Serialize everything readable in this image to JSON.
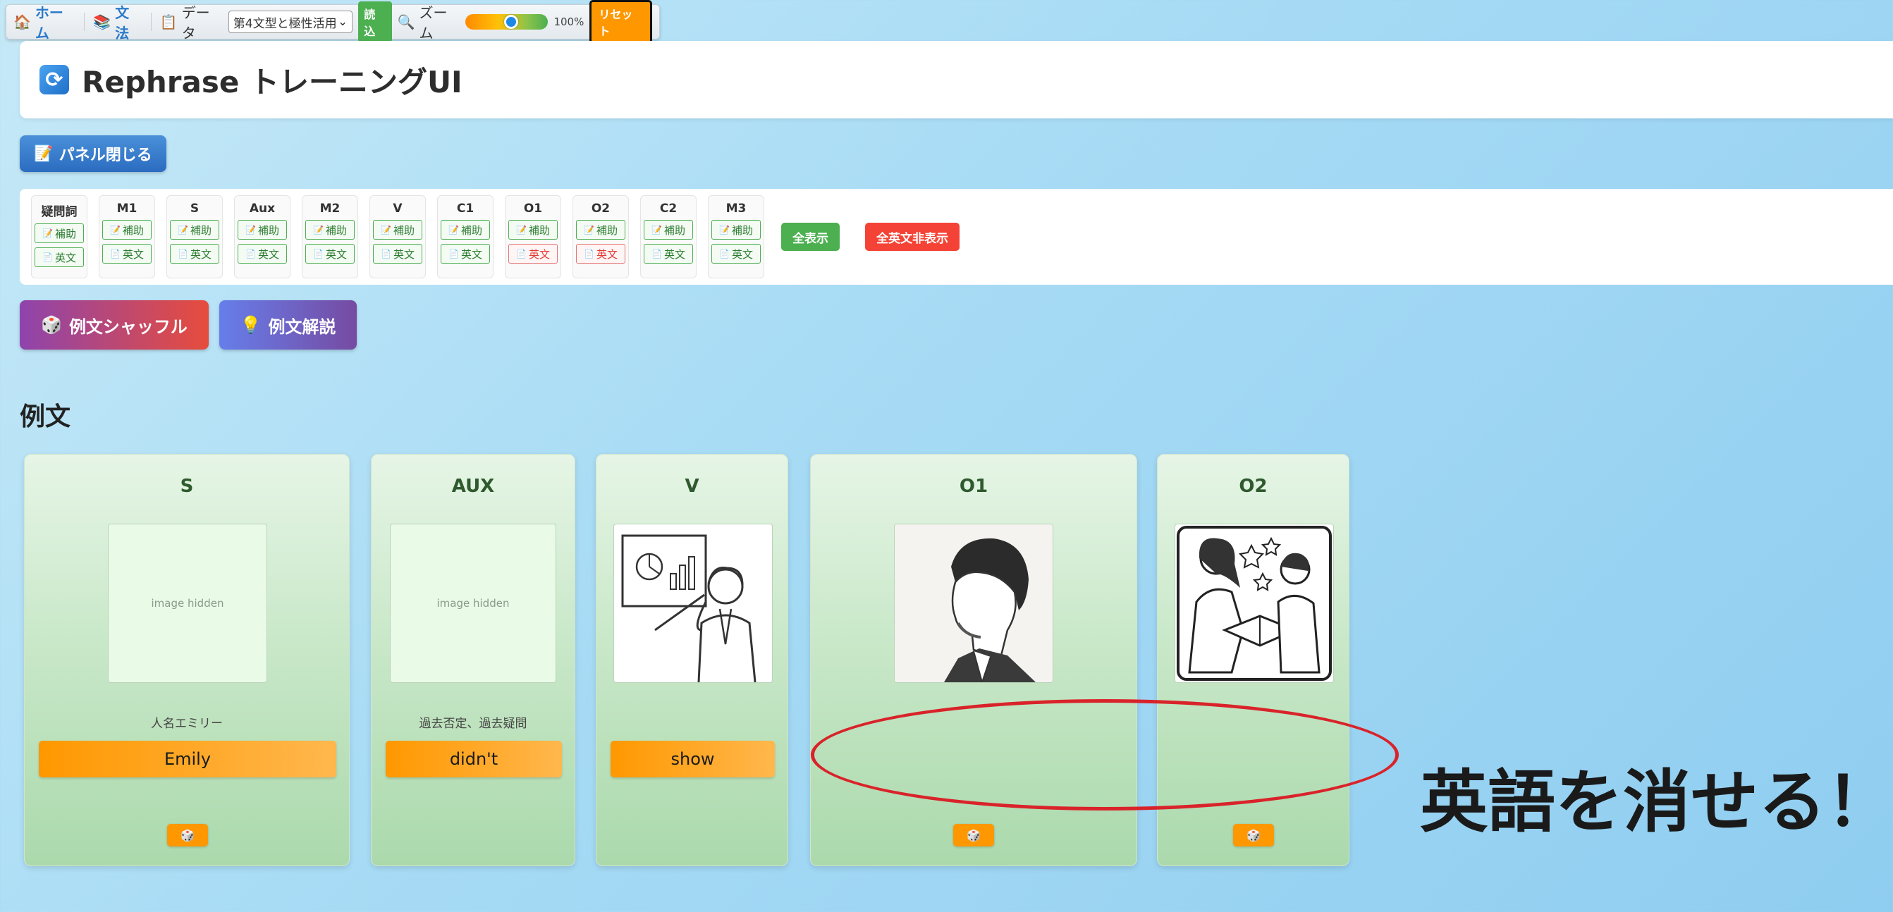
{
  "toolbar": {
    "home_label": "ホーム",
    "grammar_label": "文法",
    "data_label": "データ",
    "data_select_value": "第4文型と極性活用",
    "load_label": "読込",
    "zoom_label": "ズーム",
    "zoom_value": "100%",
    "zoom_level_fraction": 0.55,
    "reset_label": "リセット"
  },
  "header": {
    "title": "Rephrase トレーニングUI"
  },
  "panel_toggle_label": "パネル閉じる",
  "control_panel": {
    "groups": [
      {
        "label": "疑問詞",
        "aux": "補助",
        "en": "英文",
        "en_off": false
      },
      {
        "label": "M1",
        "aux": "補助",
        "en": "英文",
        "en_off": false
      },
      {
        "label": "S",
        "aux": "補助",
        "en": "英文",
        "en_off": false
      },
      {
        "label": "Aux",
        "aux": "補助",
        "en": "英文",
        "en_off": false
      },
      {
        "label": "M2",
        "aux": "補助",
        "en": "英文",
        "en_off": false
      },
      {
        "label": "V",
        "aux": "補助",
        "en": "英文",
        "en_off": false
      },
      {
        "label": "C1",
        "aux": "補助",
        "en": "英文",
        "en_off": false
      },
      {
        "label": "O1",
        "aux": "補助",
        "en": "英文",
        "en_off": true
      },
      {
        "label": "O2",
        "aux": "補助",
        "en": "英文",
        "en_off": true
      },
      {
        "label": "C2",
        "aux": "補助",
        "en": "英文",
        "en_off": false
      },
      {
        "label": "M3",
        "aux": "補助",
        "en": "英文",
        "en_off": false
      }
    ],
    "show_all_label": "全表示",
    "hide_all_en_label": "全英文非表示"
  },
  "actions": {
    "shuffle_label": "例文シャッフル",
    "explain_label": "例文解説"
  },
  "section_title": "例文",
  "cards": [
    {
      "label": "S",
      "image_hidden_text": "image hidden",
      "hint": "人名エミリー",
      "word": "Emily"
    },
    {
      "label": "AUX",
      "image_hidden_text": "image hidden",
      "hint": "過去否定、過去疑問",
      "word": "didn't"
    },
    {
      "label": "V",
      "hint": "",
      "word": "show"
    },
    {
      "label": "O1",
      "hint": "",
      "word": ""
    },
    {
      "label": "O2",
      "hint": "",
      "word": ""
    }
  ],
  "annotation": {
    "text": "英語を消せる！",
    "color": "#d9232a"
  }
}
